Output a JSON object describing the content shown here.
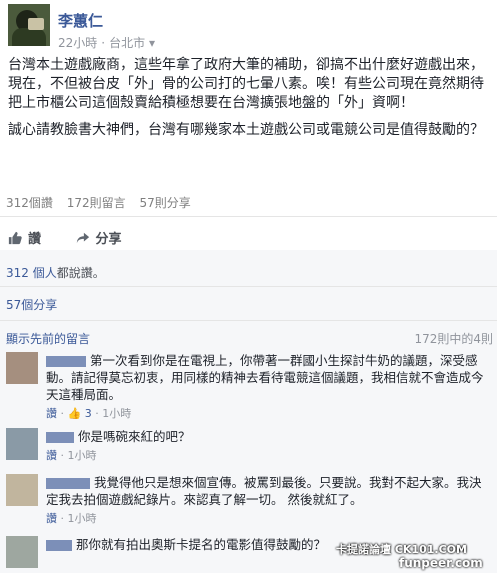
{
  "post": {
    "author": "李蕙仁",
    "time": "22小時",
    "location": "台北市",
    "paragraphs": [
      "台灣本土遊戲廠商，這些年拿了政府大筆的補助，卻搞不出什麼好遊戲出來，現在，不但被台皮「外」骨的公司打的七暈八素。唉！有些公司現在竟然期待把上市櫃公司這個殼賣給積極想要在台灣擴張地盤的「外」資啊！",
      "誠心請教臉書大神們，台灣有哪幾家本土遊戲公司或電競公司是值得鼓勵的？"
    ],
    "stats": {
      "likes": "312個讚",
      "comments": "172則留言",
      "shares": "57則分享"
    },
    "actions": {
      "like": "讚",
      "share": "分享"
    }
  },
  "reactions": {
    "likes_count": "312 個人",
    "likes_suffix": "都說讚。",
    "shares": "57個分享"
  },
  "comments_section": {
    "view_previous": "顯示先前的留言",
    "counter": "172則中的4則",
    "items": [
      {
        "text": "第一次看到你是在電視上，你帶著一群國小生探討牛奶的議題，深受感動。請記得莫忘初衷，用同樣的精神去看待電競這個議題，我相信就不會造成今天這種局面。",
        "like": "讚",
        "likes": "3",
        "time": "1小時"
      },
      {
        "text": "你是嗎碗來紅的吧？",
        "like": "讚",
        "time": "1小時"
      },
      {
        "text": "我覺得他只是想來個宣傳。被罵到最後。只要說。我對不起大家。我決定我去拍個遊戲紀錄片。來認真了解一切。 然後就紅了。",
        "like": "讚",
        "time": "1小時"
      },
      {
        "text": "那你就有拍出奧斯卡提名的電影值得鼓勵的？",
        "like": "",
        "time": ""
      }
    ]
  },
  "watermarks": {
    "line1": "卡提諾論壇 CK101.COM",
    "line2": "funpeer.com"
  }
}
